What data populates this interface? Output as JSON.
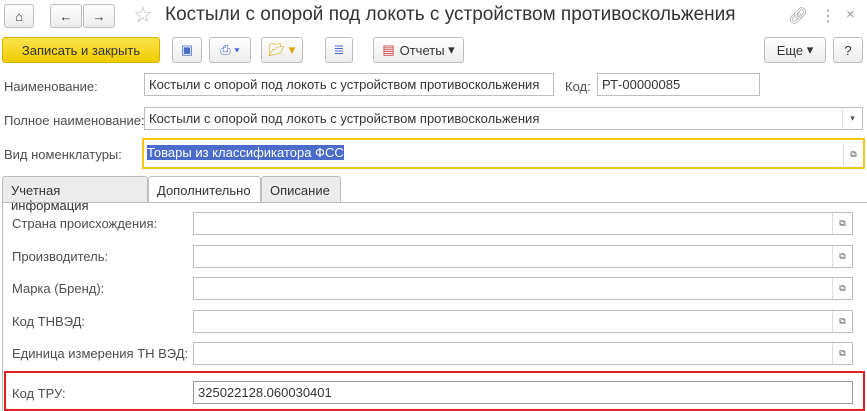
{
  "window": {
    "title": "Костыли с опорой под локоть с устройством противоскольжения"
  },
  "toolbar": {
    "save_close": "Записать и закрыть",
    "reports": "Отчеты",
    "more": "Еще",
    "help": "?"
  },
  "fields": {
    "name_label": "Наименование:",
    "name_value": "Костыли с опорой под локоть с устройством противоскольжения",
    "code_label": "Код:",
    "code_value": "РТ-00000085",
    "fullname_label": "Полное наименование:",
    "fullname_value": "Костыли с опорой под локоть с устройством противоскольжения",
    "kind_label": "Вид номенклатуры:",
    "kind_value": "Товары из классификатора ФСС"
  },
  "tabs": [
    {
      "label": "Учетная информация"
    },
    {
      "label": "Дополнительно"
    },
    {
      "label": "Описание"
    }
  ],
  "extra": [
    {
      "label": "Страна происхождения:",
      "value": ""
    },
    {
      "label": "Производитель:",
      "value": ""
    },
    {
      "label": "Марка (Бренд):",
      "value": ""
    },
    {
      "label": "Код ТНВЭД:",
      "value": ""
    },
    {
      "label": "Единица измерения ТН ВЭД:",
      "value": ""
    }
  ],
  "tru": {
    "label": "Код ТРУ:",
    "value": "325022128.060030401"
  },
  "colors": {
    "accent": "#f5d51d",
    "highlight": "#e02020",
    "selection": "#4a6bc9"
  }
}
